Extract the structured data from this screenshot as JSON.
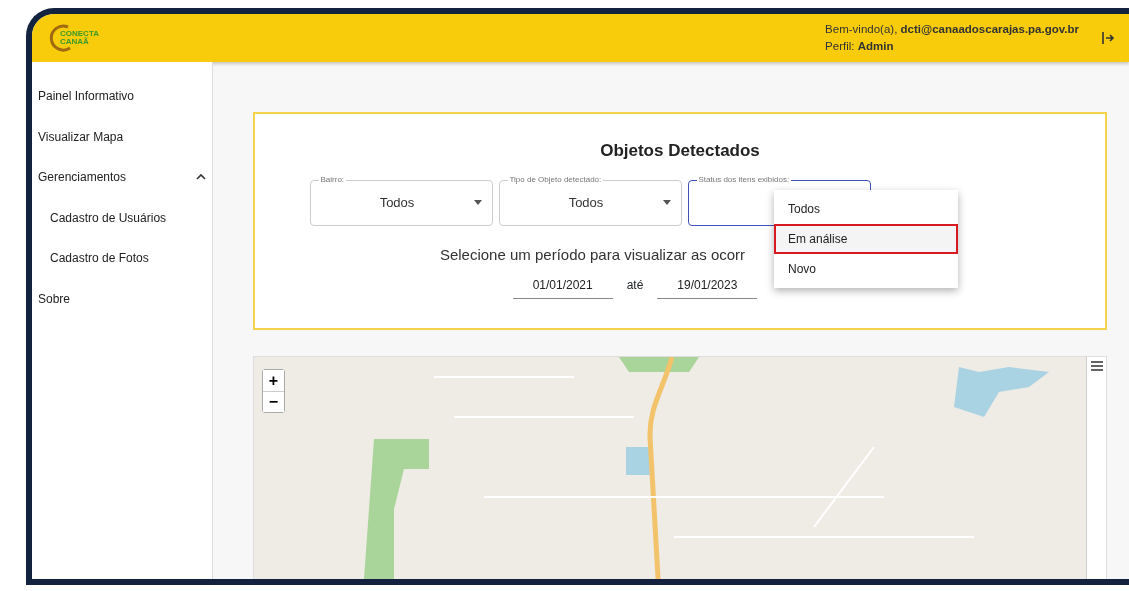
{
  "header": {
    "logo_text": "CONECTA CANAÃ",
    "welcome_label": "Bem-vindo(a),",
    "user_email": "dcti@canaadoscarajas.pa.gov.br",
    "profile_label": "Perfil:",
    "profile_value": "Admin"
  },
  "sidebar": {
    "items": [
      {
        "label": "Painel Informativo"
      },
      {
        "label": "Visualizar Mapa"
      },
      {
        "label": "Gerenciamentos",
        "expanded": true,
        "children": [
          {
            "label": "Cadastro de Usuários"
          },
          {
            "label": "Cadastro de Fotos"
          }
        ]
      },
      {
        "label": "Sobre"
      }
    ]
  },
  "panel": {
    "title": "Objetos Detectados",
    "filters": [
      {
        "label": "Bairro:",
        "value": "Todos",
        "open": false
      },
      {
        "label": "Tipo de Objeto detectado:",
        "value": "Todos",
        "open": false
      },
      {
        "label": "Status dos itens exibidos:",
        "open": true,
        "options": [
          {
            "label": "Todos",
            "highlighted": false
          },
          {
            "label": "Em análise",
            "highlighted": true
          },
          {
            "label": "Novo",
            "highlighted": false
          }
        ]
      }
    ],
    "period_prompt": "Selecione um período para visualizar as ocorr",
    "date_from": "01/01/2021",
    "date_separator": "até",
    "date_to": "19/01/2023"
  },
  "map": {
    "zoom_in": "+",
    "zoom_out": "−"
  }
}
